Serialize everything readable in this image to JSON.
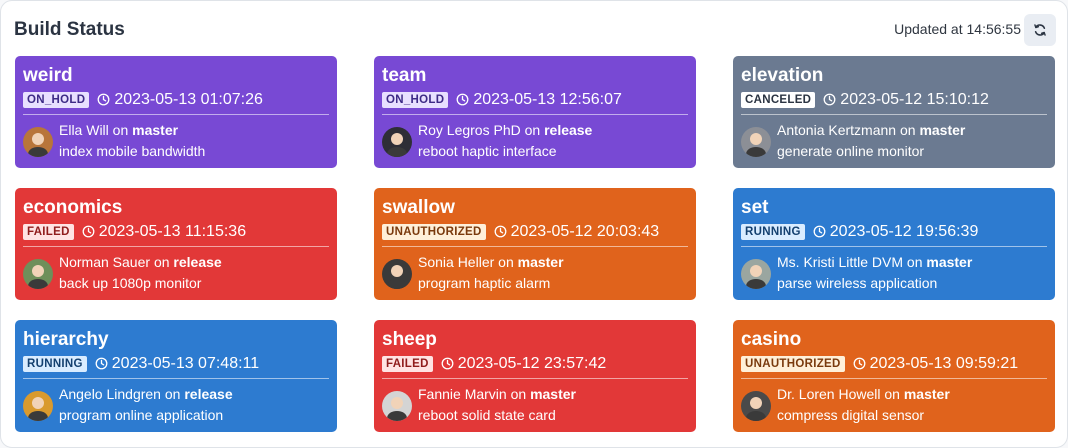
{
  "header": {
    "title": "Build Status",
    "updated": "Updated at 14:56:55",
    "refresh_icon": "refresh-icon"
  },
  "on_word": "on",
  "builds": [
    {
      "name": "weird",
      "status": "ON_HOLD",
      "time": "2023-05-13 01:07:26",
      "author": "Ella Will",
      "branch": "master",
      "message": "index mobile bandwidth",
      "color": "#7849d4",
      "badge_bg": "#e8e0ff",
      "badge_fg": "#3d2a86",
      "avatar_bg": "#b8753a"
    },
    {
      "name": "team",
      "status": "ON_HOLD",
      "time": "2023-05-13 12:56:07",
      "author": "Roy Legros PhD",
      "branch": "release",
      "message": "reboot haptic interface",
      "color": "#7849d4",
      "badge_bg": "#e8e0ff",
      "badge_fg": "#3d2a86",
      "avatar_bg": "#2e2e36"
    },
    {
      "name": "elevation",
      "status": "CANCELED",
      "time": "2023-05-12 15:10:12",
      "author": "Antonia Kertzmann",
      "branch": "master",
      "message": "generate online monitor",
      "color": "#6b7a91",
      "badge_bg": "#ffffff",
      "badge_fg": "#2b3442",
      "avatar_bg": "#8c8f96"
    },
    {
      "name": "economics",
      "status": "FAILED",
      "time": "2023-05-13 11:15:36",
      "author": "Norman Sauer",
      "branch": "release",
      "message": "back up 1080p monitor",
      "color": "#e23838",
      "badge_bg": "#ffe3e3",
      "badge_fg": "#8f1c1c",
      "avatar_bg": "#6e8f5a"
    },
    {
      "name": "swallow",
      "status": "UNAUTHORIZED",
      "time": "2023-05-12 20:03:43",
      "author": "Sonia Heller",
      "branch": "master",
      "message": "program haptic alarm",
      "color": "#e0631c",
      "badge_bg": "#fff0d9",
      "badge_fg": "#7a3a0d",
      "avatar_bg": "#3a3a3a"
    },
    {
      "name": "set",
      "status": "RUNNING",
      "time": "2023-05-12 19:56:39",
      "author": "Ms. Kristi Little DVM",
      "branch": "master",
      "message": "parse wireless application",
      "color": "#2d7bd0",
      "badge_bg": "#d9ecff",
      "badge_fg": "#14406f",
      "avatar_bg": "#9aa6a0"
    },
    {
      "name": "hierarchy",
      "status": "RUNNING",
      "time": "2023-05-13 07:48:11",
      "author": "Angelo Lindgren",
      "branch": "release",
      "message": "program online application",
      "color": "#2d7bd0",
      "badge_bg": "#d9ecff",
      "badge_fg": "#14406f",
      "avatar_bg": "#d99a2e"
    },
    {
      "name": "sheep",
      "status": "FAILED",
      "time": "2023-05-12 23:57:42",
      "author": "Fannie Marvin",
      "branch": "master",
      "message": "reboot solid state card",
      "color": "#e23838",
      "badge_bg": "#ffe3e3",
      "badge_fg": "#8f1c1c",
      "avatar_bg": "#d4d4d4"
    },
    {
      "name": "casino",
      "status": "UNAUTHORIZED",
      "time": "2023-05-13 09:59:21",
      "author": "Dr. Loren Howell",
      "branch": "master",
      "message": "compress digital sensor",
      "color": "#e0631c",
      "badge_bg": "#fff0d9",
      "badge_fg": "#7a3a0d",
      "avatar_bg": "#4a4a4a"
    }
  ]
}
